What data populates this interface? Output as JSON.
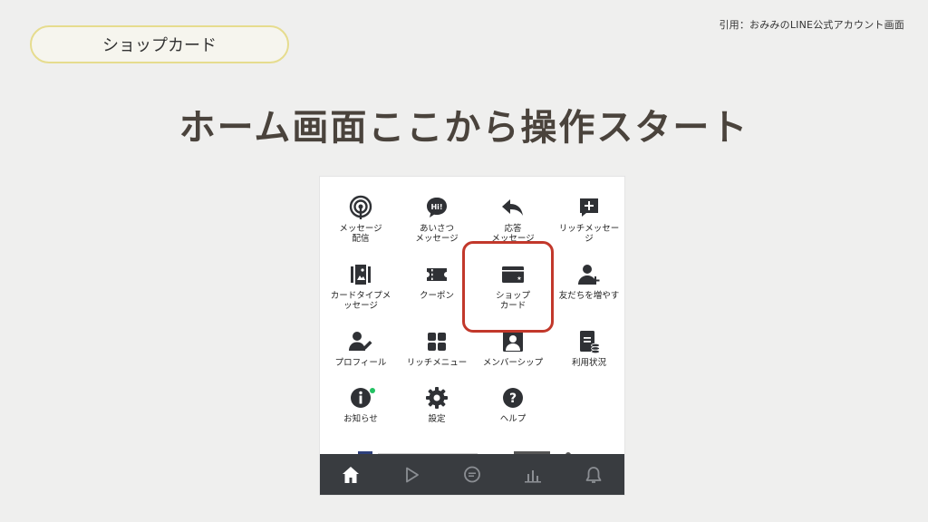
{
  "citation": "引用：おみみのLINE公式アカウント画面",
  "section_pill": "ショップカード",
  "headline": "ホーム画面ここから操作スタート",
  "menu": {
    "items": [
      {
        "label": "メッセージ\n配信",
        "icon": "broadcast-icon"
      },
      {
        "label": "あいさつ\nメッセージ",
        "icon": "hi-bubble-icon"
      },
      {
        "label": "応答\nメッセージ",
        "icon": "reply-arrow-icon"
      },
      {
        "label": "リッチメッセー\nジ",
        "icon": "rich-message-icon"
      },
      {
        "label": "カードタイプメ\nッセージ",
        "icon": "card-type-icon"
      },
      {
        "label": "クーポン",
        "icon": "coupon-icon"
      },
      {
        "label": "ショップ\nカード",
        "icon": "shop-card-icon"
      },
      {
        "label": "友だちを増やす",
        "icon": "add-friend-icon"
      },
      {
        "label": "プロフィール",
        "icon": "profile-icon"
      },
      {
        "label": "リッチメニュー",
        "icon": "rich-menu-icon"
      },
      {
        "label": "メンバーシップ",
        "icon": "membership-icon"
      },
      {
        "label": "利用状況",
        "icon": "usage-icon"
      },
      {
        "label": "お知らせ",
        "icon": "info-icon"
      },
      {
        "label": "設定",
        "icon": "gear-icon"
      },
      {
        "label": "ヘルプ",
        "icon": "help-icon"
      }
    ]
  },
  "tabbar": {
    "items": [
      "home-icon",
      "play-icon",
      "chat-icon",
      "chart-icon",
      "bell-icon"
    ],
    "active": "home-icon"
  },
  "colors": {
    "background": "#efefee",
    "pill_border": "#e6dc8e",
    "highlight": "#c2382b",
    "tabbar": "#393c40",
    "notification_dot": "#23c163",
    "icon": "#2f3135"
  }
}
